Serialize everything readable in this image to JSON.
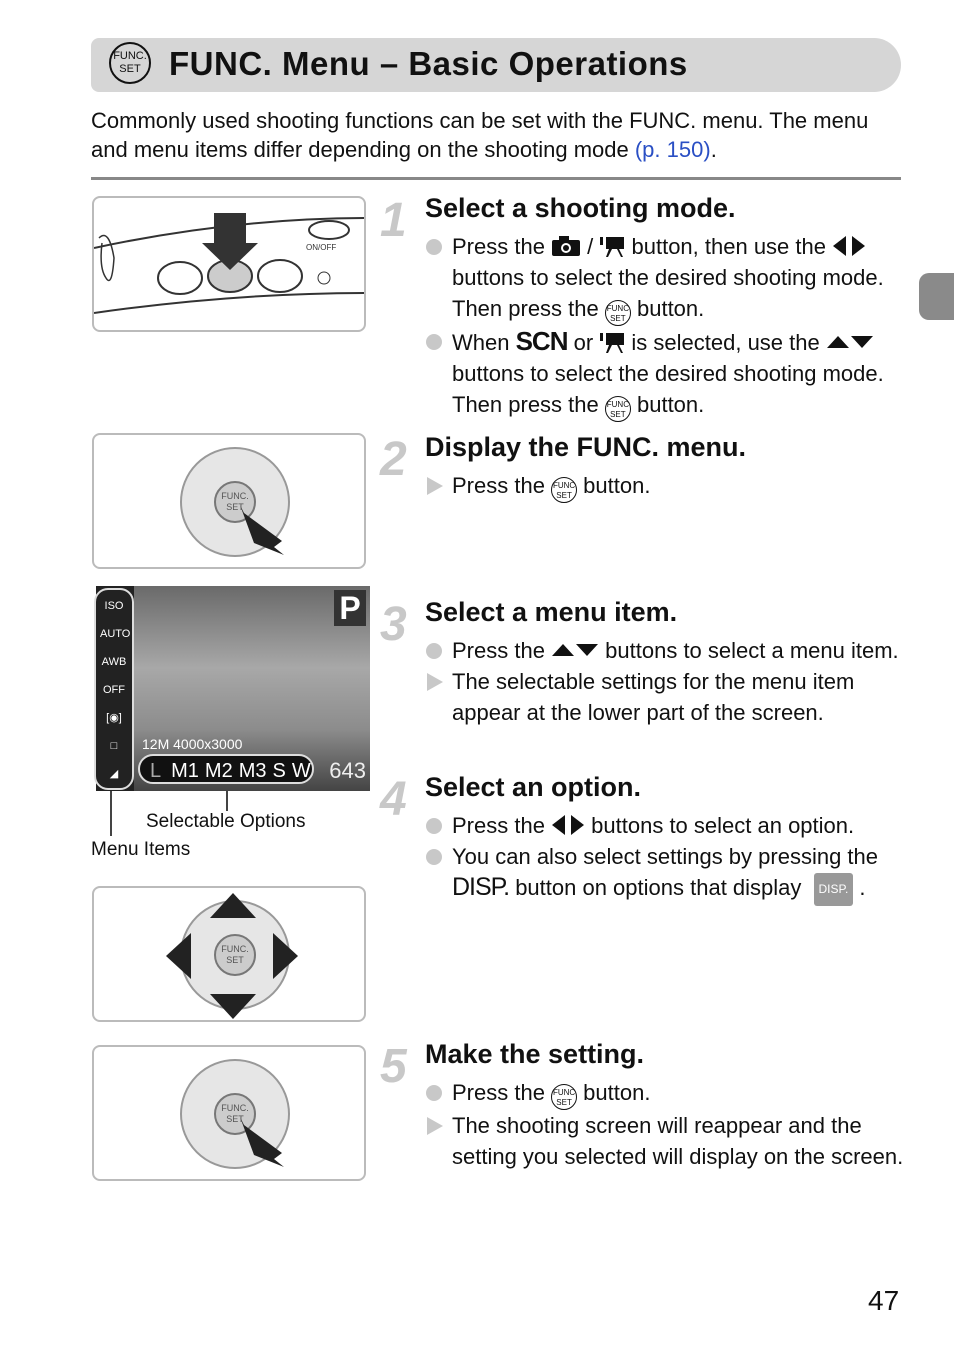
{
  "header": {
    "icon_text": "FUNC. SET",
    "title": "FUNC. Menu – Basic Operations"
  },
  "intro": {
    "text": "Commonly used shooting functions can be set with the FUNC. menu. The menu and menu items differ depending on the shooting mode ",
    "link": "(p. 150)",
    "end": "."
  },
  "steps": [
    {
      "num": "1",
      "title": "Select a shooting mode.",
      "items": [
        {
          "type": "bullet",
          "parts": [
            "Press the ",
            "camera-icon",
            " / ",
            "movie-icon",
            " button, then use the ",
            "left-right-icon",
            " buttons to select the desired shooting mode. Then press the ",
            "func-icon",
            " button."
          ]
        },
        {
          "type": "bullet",
          "parts": [
            "When ",
            "scn-icon",
            " or ",
            "movie-icon",
            " is selected, use the ",
            "up-down-icon",
            " buttons to select the desired shooting mode. Then press the ",
            "func-icon",
            " button."
          ]
        }
      ]
    },
    {
      "num": "2",
      "title": "Display the FUNC. menu.",
      "items": [
        {
          "type": "result",
          "parts": [
            "Press the ",
            "func-icon",
            " button."
          ]
        }
      ]
    },
    {
      "num": "3",
      "title": "Select a menu item.",
      "items": [
        {
          "type": "bullet",
          "parts": [
            "Press the ",
            "up-down-icon",
            " buttons to select a menu item."
          ]
        },
        {
          "type": "result",
          "parts": [
            "The selectable settings for the menu item appear at the lower part of the screen."
          ]
        }
      ]
    },
    {
      "num": "4",
      "title": "Select an option.",
      "items": [
        {
          "type": "bullet",
          "parts": [
            "Press the ",
            "left-right-icon",
            " buttons to select an option."
          ]
        },
        {
          "type": "bullet",
          "parts": [
            "You can also select settings by pressing the ",
            "disp-icon",
            " button on options that display ",
            "disp-badge-icon",
            " ."
          ]
        }
      ]
    },
    {
      "num": "5",
      "title": "Make the setting.",
      "items": [
        {
          "type": "bullet",
          "parts": [
            "Press the ",
            "func-icon",
            " button."
          ]
        },
        {
          "type": "result",
          "parts": [
            "The shooting screen will reappear and the setting you selected will display on the screen."
          ]
        }
      ]
    }
  ],
  "screen": {
    "mode": "P",
    "left_items": [
      "ISO AUTO",
      "AWB",
      "OFF",
      "[◉]",
      "□",
      "◢",
      "L"
    ],
    "size_info": "12M 4000x3000",
    "options": [
      "L",
      "M1",
      "M2",
      "M3",
      "S",
      "W"
    ],
    "shots": "643"
  },
  "labels": {
    "selectable_options": "Selectable Options",
    "menu_items": "Menu Items",
    "on_off": "ON/OFF",
    "func": "FUNC.",
    "set": "SET"
  },
  "page_number": "47"
}
